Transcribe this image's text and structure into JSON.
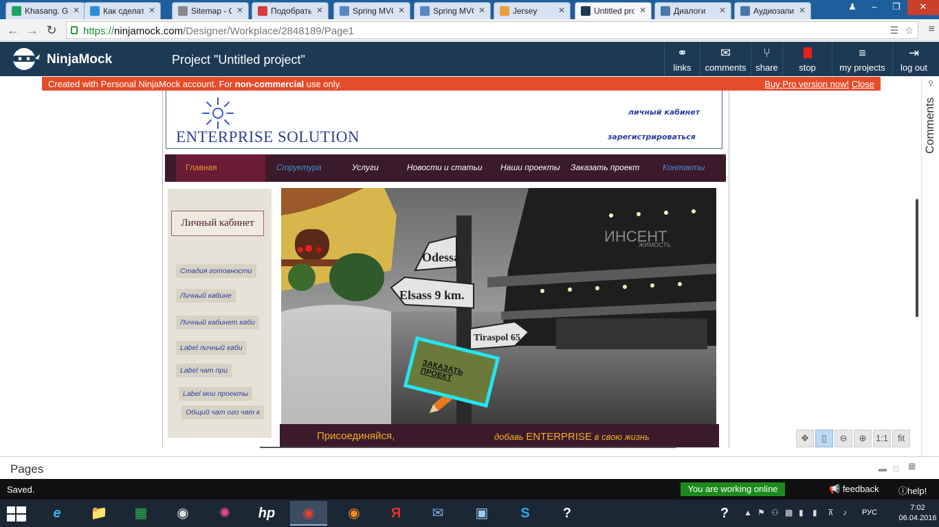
{
  "browser": {
    "tabs": [
      {
        "label": "Khasang. Gе",
        "favicon_color": "#1aa260"
      },
      {
        "label": "Как сделать",
        "favicon_color": "#2a8fd6"
      },
      {
        "label": "Sitemap - C",
        "favicon_color": "#888888"
      },
      {
        "label": "Подобрать",
        "favicon_color": "#d43c3c"
      },
      {
        "label": "Spring MVC",
        "favicon_color": "#5b86c0"
      },
      {
        "label": "Spring MVC",
        "favicon_color": "#5b86c0"
      },
      {
        "label": "Jersey",
        "favicon_color": "#e8a13a"
      },
      {
        "label": "Untitled pro",
        "favicon_color": "#1d3a55"
      },
      {
        "label": "Диалоги",
        "favicon_color": "#4a76a8"
      },
      {
        "label": "Аудиозапи",
        "favicon_color": "#4a76a8"
      }
    ],
    "active_tab": 7,
    "url_scheme": "https://",
    "url_host": "ninjamock.com",
    "url_path": "/Designer/Workplace/2848189/Page1"
  },
  "app": {
    "brand": "NinjaMock",
    "project_title": "Project \"Untitled project\"",
    "actions": [
      {
        "label": "links",
        "icon": "link-icon"
      },
      {
        "label": "comments",
        "icon": "comments-icon"
      },
      {
        "label": "share",
        "icon": "share-icon"
      },
      {
        "label": "stop",
        "icon": "stop-icon"
      },
      {
        "label": "my projects",
        "icon": "layers-icon"
      },
      {
        "label": "log out",
        "icon": "logout-icon"
      }
    ],
    "banner_text_pre": "Created with Personal NinjaMock account. For ",
    "banner_text_bold": "non-commercial",
    "banner_text_post": " use only.",
    "banner_buy": "Buy Pro version now!",
    "banner_close": "Close",
    "accent_color": "#e44c2a",
    "header_color": "#1d3a55"
  },
  "mockup": {
    "logo_text": "ENTERPRISE SOLUTION",
    "link_cabinet": "личный кабинет",
    "link_register": "зарегистрироваться",
    "nav": [
      "Главная",
      "Структура",
      "Услуги",
      "Новости и статьи",
      "Наши проекты",
      "Заказать проект",
      "Контакты"
    ],
    "side_title": "Личный кабинет",
    "side_items": [
      "Стадия готовности",
      "Личный кабине",
      "Личный кабинет каби",
      "Label личный каби",
      "Label чат при",
      "Label мои проекты",
      "Общий чат ого чат к"
    ],
    "sign_odessa": "Odessa",
    "sign_elsass": "Elsass 9 km.",
    "sign_tiraspol": "Tiraspol 65",
    "watermark": "ИНСЕНТ",
    "watermark_sub": "ЖИМОСТЬ",
    "order_badge": "ЗАКАЗАТЬ ПРОЕКТ",
    "strip_left": "Присоединяйся,",
    "strip_right_pre": "добавь ",
    "strip_right_brand": "ENTERPRISE",
    "strip_right_post": " в свою жизнь"
  },
  "rail": {
    "label": "Comments"
  },
  "zoom": {
    "one_to_one": "1:1",
    "fit": "fit"
  },
  "pages": {
    "label": "Pages"
  },
  "status": {
    "saved": "Saved.",
    "online": "You are working online",
    "feedback": "feedback",
    "help": "help!"
  },
  "taskbar": {
    "lang": "РУС",
    "time": "7:02",
    "date": "06.04.2016"
  }
}
